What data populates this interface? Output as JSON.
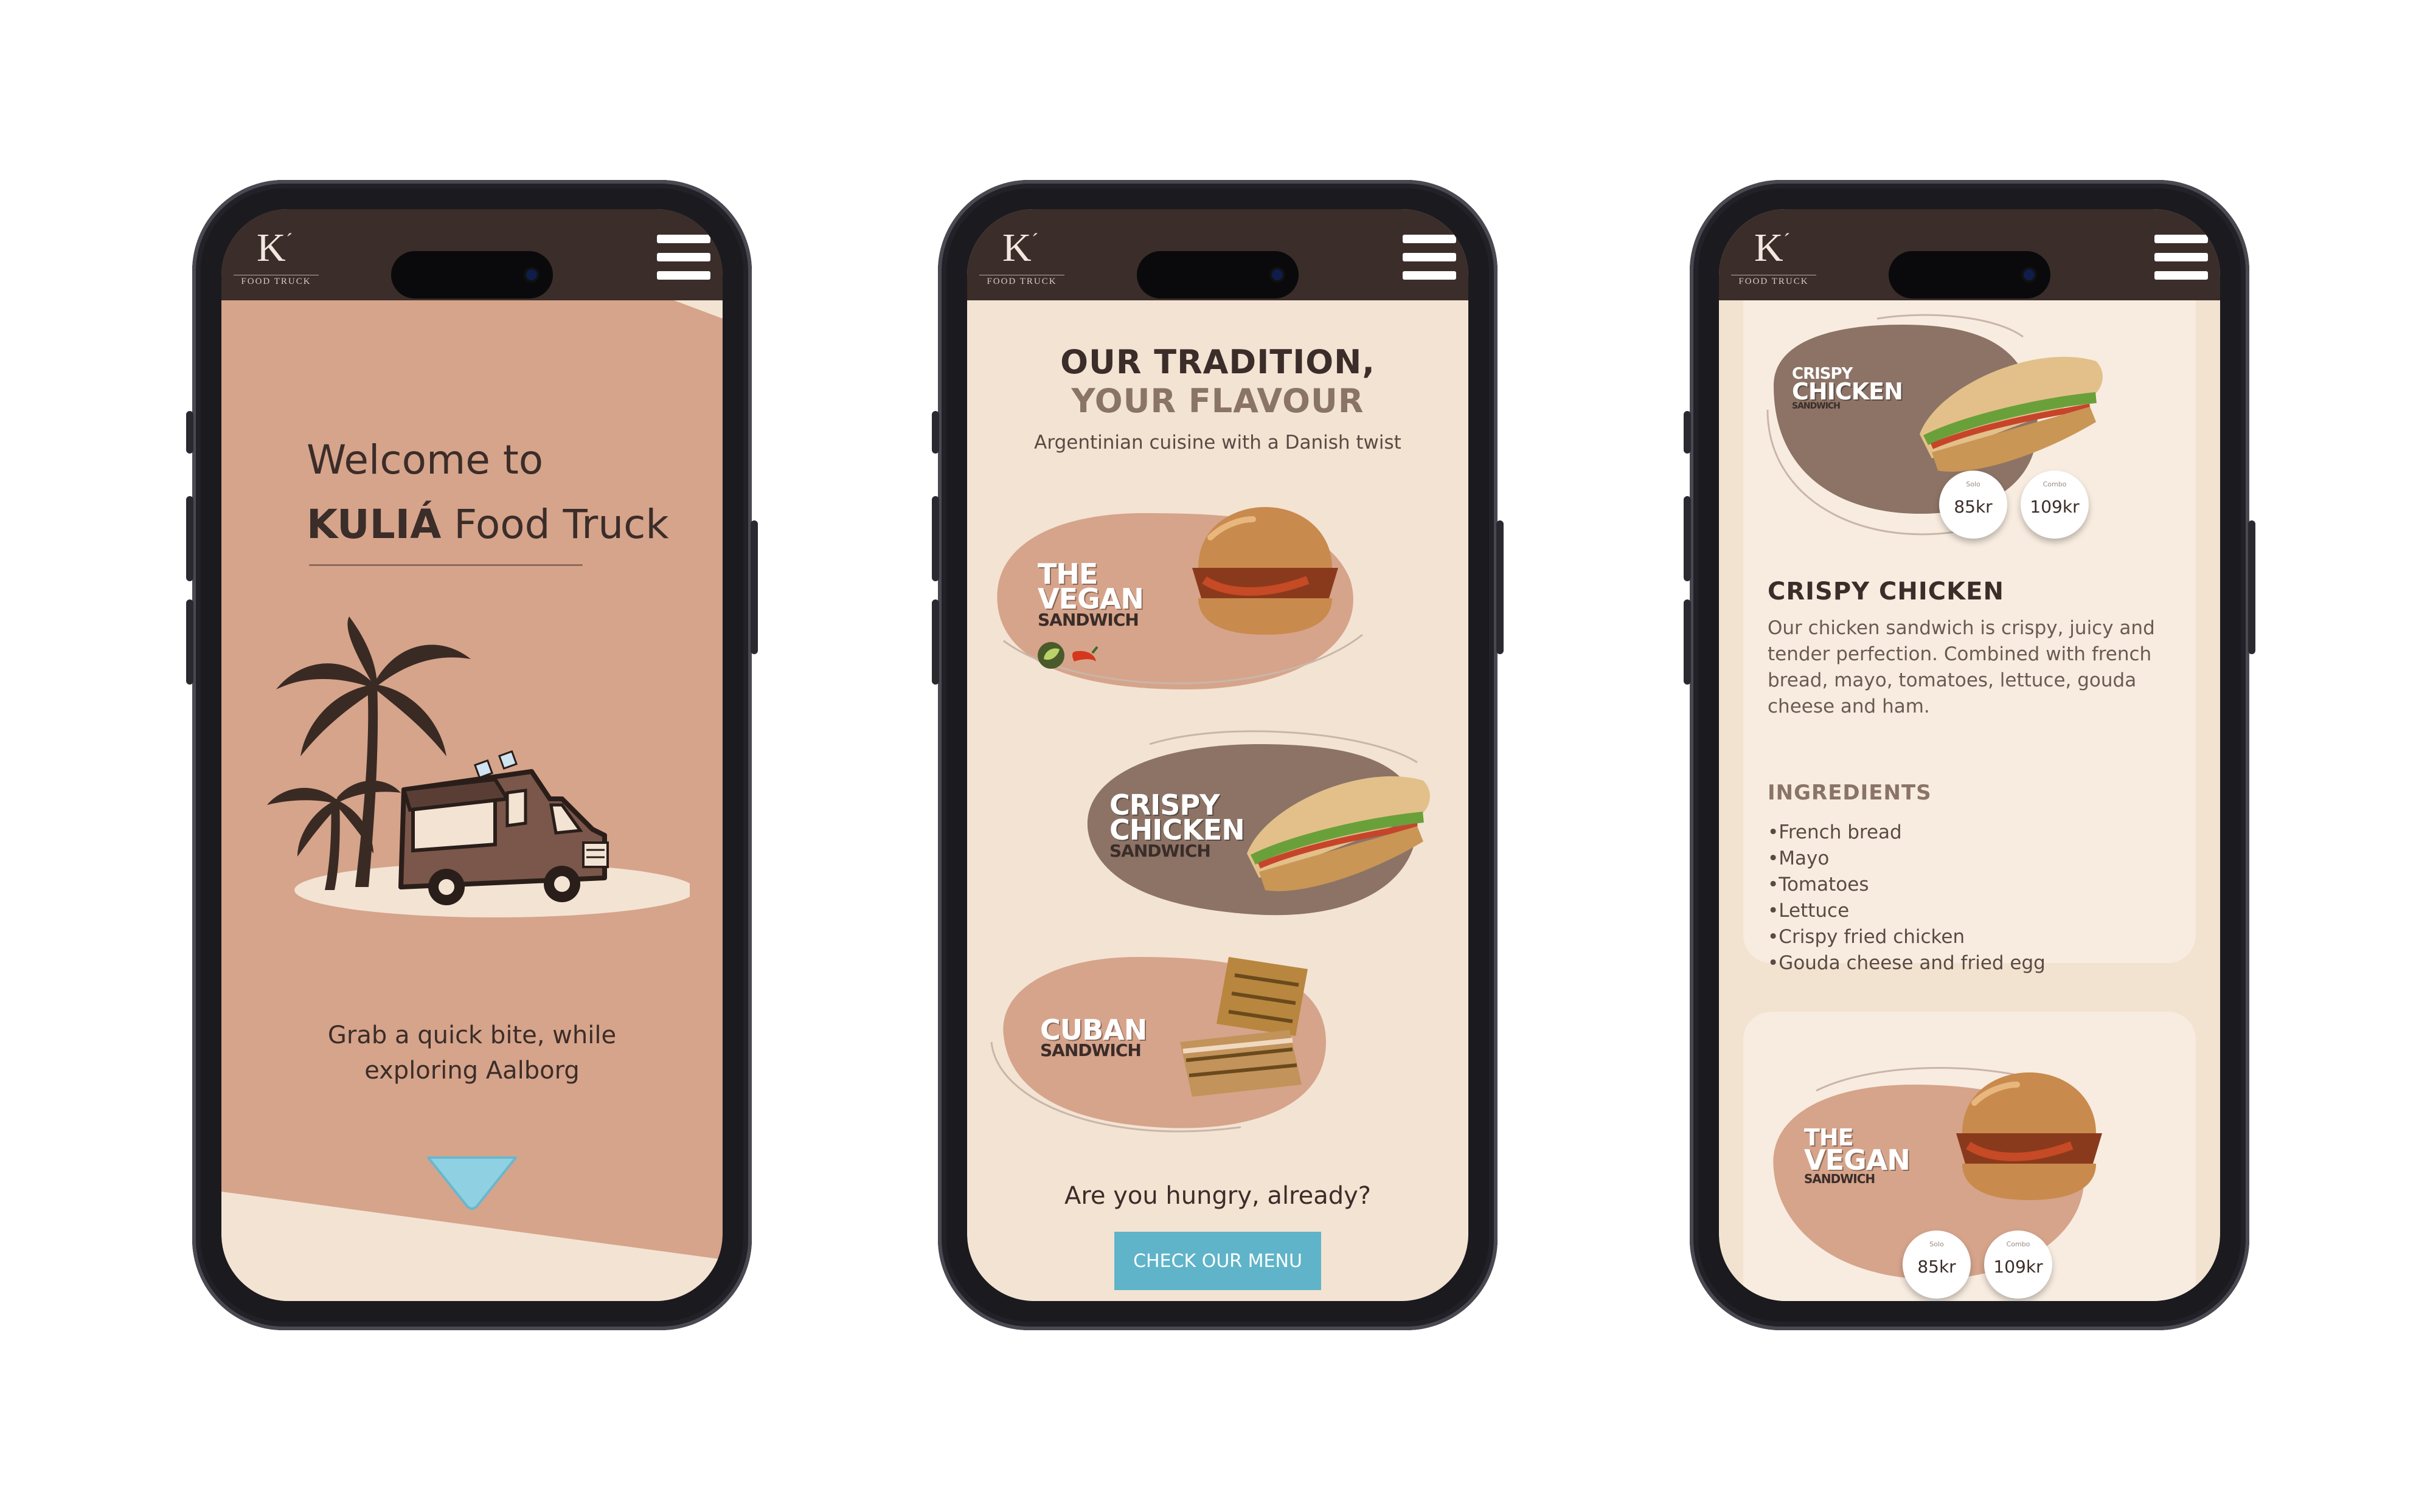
{
  "brand": {
    "logo_letter": "K",
    "logo_tick": "´",
    "logo_sub": "FOOD TRUCK"
  },
  "screen1": {
    "welcome_line1": "Welcome to",
    "welcome_brand": "KULIÁ",
    "welcome_rest": " Food Truck",
    "tagline_line1": "Grab a quick bite, while",
    "tagline_line2": "exploring Aalborg"
  },
  "screen2": {
    "heading_line1": "OUR TRADITION,",
    "heading_line2": "YOUR FLAVOUR",
    "subtitle": "Argentinian cuisine with a Danish twist",
    "cards": [
      {
        "line1": "THE",
        "line2": "VEGAN",
        "line3": "SANDWICH"
      },
      {
        "line1": "CRISPY",
        "line2": "CHICKEN",
        "line3": "SANDWICH"
      },
      {
        "line1": "CUBAN",
        "line2": "SANDWICH"
      }
    ],
    "hungry_text": "Are you hungry, already?",
    "cta_label": "CHECK OUR MENU"
  },
  "screen3": {
    "top_card": {
      "line1": "CRISPY",
      "line2": "CHICKEN",
      "line3": "SANDWICH",
      "price1_caption": "Solo",
      "price1": "85kr",
      "price2_caption": "Combo",
      "price2": "109kr"
    },
    "item_title": "CRISPY CHICKEN",
    "item_description": "Our chicken sandwich is crispy, juicy and tender perfection. Combined with french bread, mayo, tomatoes, lettuce, gouda cheese and ham.",
    "ingredients_title": "INGREDIENTS",
    "ingredients": [
      "French bread",
      "Mayo",
      "Tomatoes",
      "Lettuce",
      "Crispy fried chicken",
      "Gouda cheese and fried egg"
    ],
    "bottom_card": {
      "line1": "THE",
      "line2": "VEGAN",
      "line3": "SANDWICH",
      "price1_caption": "Solo",
      "price1": "85kr",
      "price2_caption": "Combo",
      "price2": "109kr"
    }
  },
  "colors": {
    "topbar": "#3b2d29",
    "terracotta": "#d6a48b",
    "cream": "#f3e3d3",
    "mocha": "#8c7366",
    "cta": "#5fb4c9"
  },
  "icons": [
    "hamburger-menu-icon",
    "palm-tree-icon",
    "food-truck-icon",
    "down-arrow-icon",
    "vegan-leaf-icon",
    "chili-icon"
  ]
}
